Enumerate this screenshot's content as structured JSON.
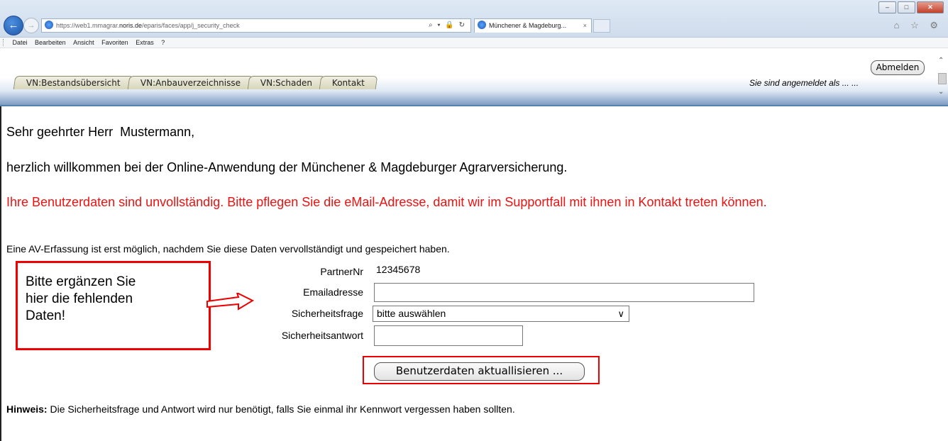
{
  "browser": {
    "url_prefix": "https://web1.mmagrar.",
    "url_domain": "noris.de",
    "url_path": "/eparis/faces/app/j_security_check",
    "address_icons": "⌕ ▾ 🔒 ↻",
    "tab_title": "Münchener & Magdeburg...",
    "tab_close": "×",
    "right_icons": "⌂ ☆ ⚙",
    "window_buttons": [
      "–",
      "□",
      "✕"
    ],
    "menu": [
      "Datei",
      "Bearbeiten",
      "Ansicht",
      "Favoriten",
      "Extras",
      "?"
    ]
  },
  "header": {
    "tabs": [
      "VN:Bestandsübersicht",
      "VN:Anbauverzeichnisse",
      "VN:Schaden",
      "Kontakt"
    ],
    "logout_label": "Abmelden",
    "logged_in_text": "Sie sind angemeldet als ... ..."
  },
  "content": {
    "greeting": "Sehr geehrter Herr",
    "name": "Mustermann,",
    "welcome": "herzlich willkommen bei der Online-Anwendung der Münchener & Magdeburger Agrarversicherung.",
    "warning": "Ihre Benutzerdaten sind unvollständig. Bitte pflegen Sie die eMail-Adresse, damit wir im Supportfall mit ihnen in Kontakt treten können.",
    "info": "Eine AV-Erfassung ist erst möglich, nachdem Sie diese Daten vervollständigt und gespeichert haben."
  },
  "form": {
    "partner_label": "PartnerNr",
    "partner_value": "12345678",
    "email_label": "Emailadresse",
    "email_value": "",
    "question_label": "Sicherheitsfrage",
    "question_selected": "bitte auswählen",
    "answer_label": "Sicherheitsantwort",
    "answer_value": "",
    "submit_label": "Benutzerdaten aktuallisieren ..."
  },
  "callout": {
    "line1": "Bitte ergänzen Sie",
    "line2": "hier die fehlenden",
    "line3": "Daten!"
  },
  "hint": {
    "label": "Hinweis:",
    "text": " Die Sicherheitsfrage und Antwort wird nur benötigt, falls Sie einmal ihr Kennwort vergessen haben sollten."
  }
}
